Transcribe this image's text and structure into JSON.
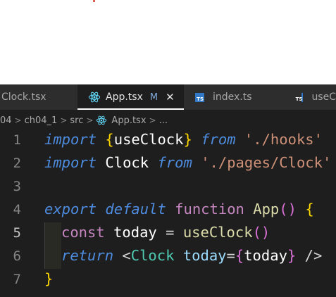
{
  "tabs": [
    {
      "label": "Clock.tsx",
      "icon": "react-icon",
      "active": false
    },
    {
      "label": "App.tsx",
      "icon": "react-icon",
      "active": true,
      "status": "M",
      "close": "✕"
    },
    {
      "label": "index.ts",
      "icon": "typescript-icon",
      "active": false
    },
    {
      "label": "useC",
      "icon": "typescript-icon",
      "active": false
    }
  ],
  "ts_badge": "TS",
  "breadcrumb": {
    "items": [
      "04",
      "ch04_1",
      "src",
      "App.tsx",
      "..."
    ],
    "separator": ">"
  },
  "code": {
    "line_numbers": [
      "1",
      "2",
      "3",
      "4",
      "5",
      "6",
      "7"
    ],
    "l1": {
      "kw1": "import",
      "ob": "{",
      "name": "useClock",
      "cb": "}",
      "kw2": "from",
      "str": "'./hooks'"
    },
    "l2": {
      "kw1": "import",
      "name": "Clock",
      "kw2": "from",
      "str": "'./pages/Clock'"
    },
    "l4": {
      "kw1": "export",
      "kw2": "default",
      "kw3": "function",
      "name": "App",
      "parens": "()",
      "ob": "{"
    },
    "l5": {
      "kw": "const",
      "name": "today",
      "eq": "=",
      "fn": "useClock",
      "parens": "()"
    },
    "l6": {
      "kw": "return",
      "lt": "<",
      "tag": "Clock",
      "attr": "today",
      "eq": "=",
      "ob": "{",
      "val": "today",
      "cb": "}",
      "close": "/>"
    },
    "l7": {
      "cb": "}"
    }
  },
  "colors": {
    "editor_bg": "#1e1e1e",
    "keyword": "#4e8ce0",
    "string": "#ce9178",
    "function": "#dcdcaa",
    "jsx_component": "#4ec9b0",
    "bracket": "#ffd700"
  }
}
